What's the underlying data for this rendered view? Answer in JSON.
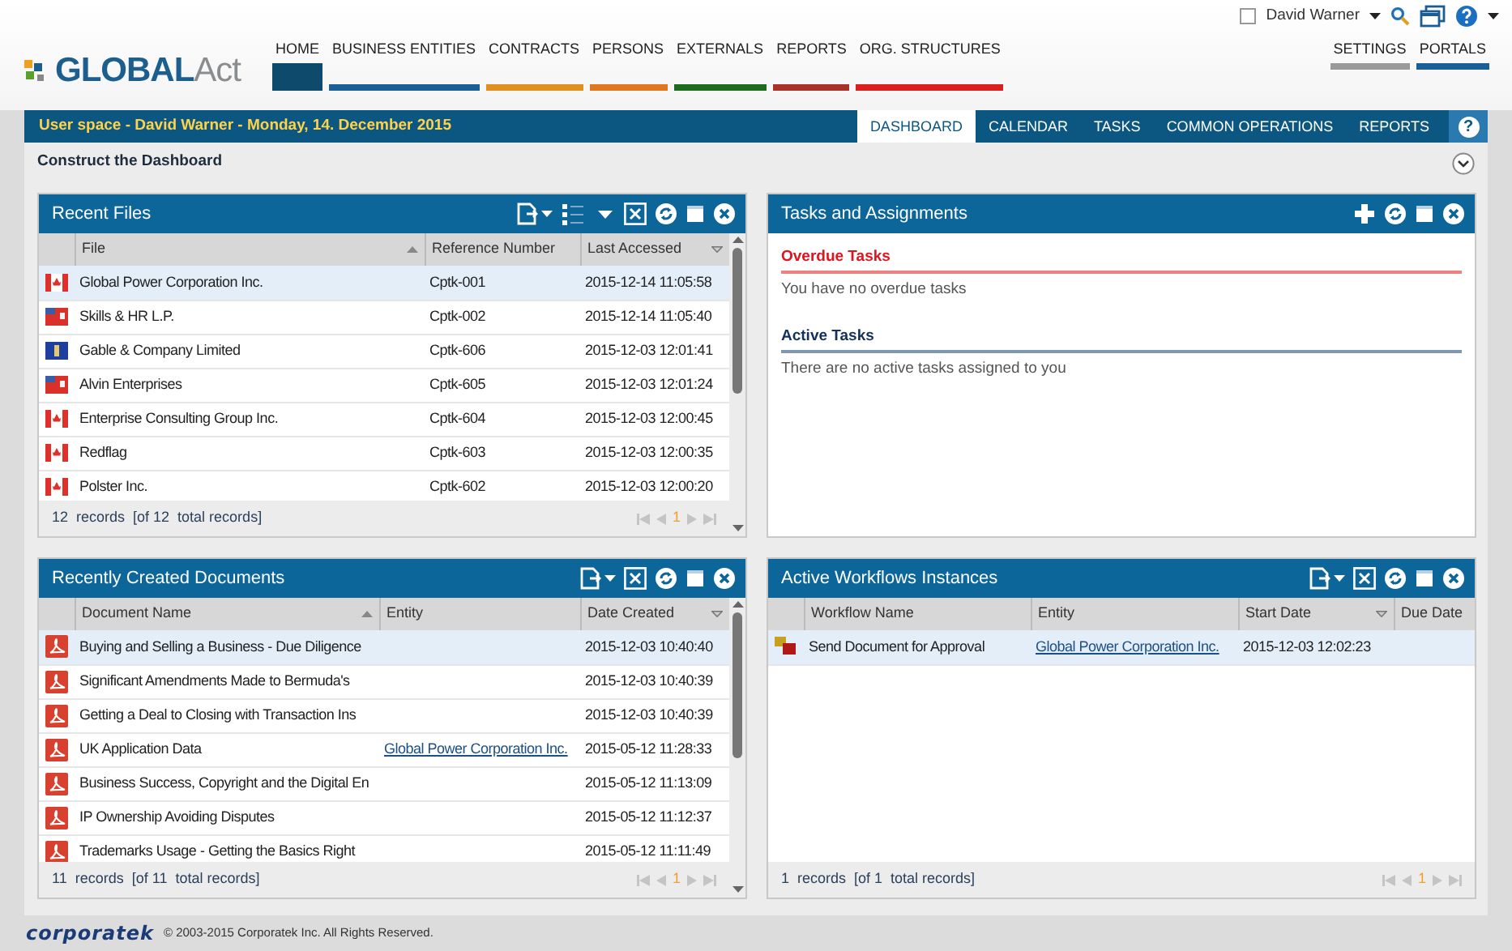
{
  "top_bar": {
    "remember": false,
    "user": "David Warner"
  },
  "logo": {
    "main": "GLOBAL",
    "accent": "Act"
  },
  "main_nav": [
    {
      "label": "HOME",
      "color": "#0d4a6b",
      "selected": true
    },
    {
      "label": "BUSINESS ENTITIES",
      "color": "#1b5f96",
      "selected": false
    },
    {
      "label": "CONTRACTS",
      "color": "#e0901e",
      "selected": false
    },
    {
      "label": "PERSONS",
      "color": "#e0761e",
      "selected": false
    },
    {
      "label": "EXTERNALS",
      "color": "#1d6b1d",
      "selected": false
    },
    {
      "label": "REPORTS",
      "color": "#a83228",
      "selected": false
    },
    {
      "label": "ORG. STRUCTURES",
      "color": "#dc1e1e",
      "selected": false
    }
  ],
  "right_nav": [
    {
      "label": "SETTINGS",
      "color": "#9a9a9a"
    },
    {
      "label": "PORTALS",
      "color": "#1b5f96"
    }
  ],
  "user_space": {
    "title": "User space - David Warner - Monday, 14. December 2015",
    "help": "?",
    "tabs": [
      {
        "label": "DASHBOARD",
        "selected": true
      },
      {
        "label": "CALENDAR",
        "selected": false
      },
      {
        "label": "TASKS",
        "selected": false
      },
      {
        "label": "COMMON OPERATIONS",
        "selected": false
      },
      {
        "label": "REPORTS",
        "selected": false
      }
    ]
  },
  "construct": {
    "label": "Construct the Dashboard",
    "expanded": false
  },
  "panels": [
    {
      "kind": "files",
      "title": "Recent Files",
      "scrollable": true,
      "columns": [
        {
          "label": "File",
          "ascending": true,
          "descending": false
        },
        {
          "label": "Reference Number",
          "ascending": false,
          "descending": false
        },
        {
          "label": "Last Accessed",
          "ascending": false,
          "descending": true
        }
      ],
      "rows": [
        {
          "kind": "canada",
          "selected": true,
          "cells": [
            {
              "text": "Global Power Corporation Inc."
            },
            {
              "text": "Cptk-001"
            },
            {
              "text": "2015-12-14 11:05:58"
            }
          ]
        },
        {
          "kind": "ensign",
          "selected": false,
          "cells": [
            {
              "text": "Skills & HR L.P."
            },
            {
              "text": "Cptk-002"
            },
            {
              "text": "2015-12-14 11:05:40"
            }
          ]
        },
        {
          "kind": "blue",
          "selected": false,
          "cells": [
            {
              "text": "Gable & Company Limited"
            },
            {
              "text": "Cptk-606"
            },
            {
              "text": "2015-12-03 12:01:41"
            }
          ]
        },
        {
          "kind": "ensign",
          "selected": false,
          "cells": [
            {
              "text": "Alvin Enterprises"
            },
            {
              "text": "Cptk-605"
            },
            {
              "text": "2015-12-03 12:01:24"
            }
          ]
        },
        {
          "kind": "canada",
          "selected": false,
          "cells": [
            {
              "text": "Enterprise Consulting Group Inc."
            },
            {
              "text": "Cptk-604"
            },
            {
              "text": "2015-12-03 12:00:45"
            }
          ]
        },
        {
          "kind": "canada",
          "selected": false,
          "cells": [
            {
              "text": "Redflag"
            },
            {
              "text": "Cptk-603"
            },
            {
              "text": "2015-12-03 12:00:35"
            }
          ]
        },
        {
          "kind": "canada",
          "selected": false,
          "cells": [
            {
              "text": "Polster Inc."
            },
            {
              "text": "Cptk-602"
            },
            {
              "text": "2015-12-03 12:00:20"
            }
          ]
        }
      ],
      "footer": "12  records  [of 12  total records]",
      "page": "1"
    },
    {
      "kind": "tasks",
      "title": "Tasks and Assignments",
      "sections": [
        {
          "kind": "overdue",
          "title": "Overdue Tasks",
          "text": "You have no overdue tasks"
        },
        {
          "kind": "active",
          "title": "Active Tasks",
          "text": "There are no active tasks assigned to you"
        }
      ]
    },
    {
      "kind": "documents",
      "title": "Recently Created Documents",
      "scrollable": true,
      "columns": [
        {
          "label": "Document Name",
          "ascending": true,
          "descending": false
        },
        {
          "label": "Entity",
          "ascending": false,
          "descending": false
        },
        {
          "label": "Date Created",
          "ascending": false,
          "descending": true
        }
      ],
      "rows": [
        {
          "selected": true,
          "cells": [
            {
              "text": "Buying and Selling a Business - Due Diligence"
            },
            {
              "text": ""
            },
            {
              "text": "2015-12-03 10:40:40"
            }
          ]
        },
        {
          "selected": false,
          "cells": [
            {
              "text": "Significant Amendments Made to Bermuda's"
            },
            {
              "text": ""
            },
            {
              "text": "2015-12-03 10:40:39"
            }
          ]
        },
        {
          "selected": false,
          "cells": [
            {
              "text": "Getting a Deal to Closing with Transaction Ins"
            },
            {
              "text": ""
            },
            {
              "text": "2015-12-03 10:40:39"
            }
          ]
        },
        {
          "selected": false,
          "cells": [
            {
              "text": "UK Application Data"
            },
            {
              "text": "Global Power Corporation Inc.",
              "link": true
            },
            {
              "text": "2015-05-12 11:28:33"
            }
          ]
        },
        {
          "selected": false,
          "cells": [
            {
              "text": "Business Success, Copyright and the Digital En"
            },
            {
              "text": ""
            },
            {
              "text": "2015-05-12 11:13:09"
            }
          ]
        },
        {
          "selected": false,
          "cells": [
            {
              "text": "IP Ownership Avoiding Disputes"
            },
            {
              "text": ""
            },
            {
              "text": "2015-05-12 11:12:37"
            }
          ]
        },
        {
          "selected": false,
          "cells": [
            {
              "text": "Trademarks Usage - Getting the Basics Right"
            },
            {
              "text": ""
            },
            {
              "text": "2015-05-12 11:11:49"
            }
          ]
        }
      ],
      "footer": "11  records  [of 11  total records]",
      "page": "1"
    },
    {
      "kind": "workflows",
      "title": "Active Workflows Instances",
      "columns": [
        {
          "label": "Workflow Name",
          "ascending": false,
          "descending": false
        },
        {
          "label": "Entity",
          "ascending": false,
          "descending": false
        },
        {
          "label": "Start Date",
          "ascending": false,
          "descending": true
        },
        {
          "label": "Due Date",
          "ascending": false,
          "descending": false
        }
      ],
      "rows": [
        {
          "selected": true,
          "cells": [
            {
              "text": "Send Document for Approval"
            },
            {
              "text": "Global Power Corporation Inc.",
              "link": true
            },
            {
              "text": "2015-12-03 12:02:23"
            },
            {
              "text": ""
            }
          ]
        }
      ],
      "footer": "1  records  [of 1  total records]",
      "page": "1"
    }
  ],
  "footer": {
    "brand": "corporatek",
    "copyright": "© 2003-2015 Corporatek Inc.  All Rights Reserved."
  }
}
